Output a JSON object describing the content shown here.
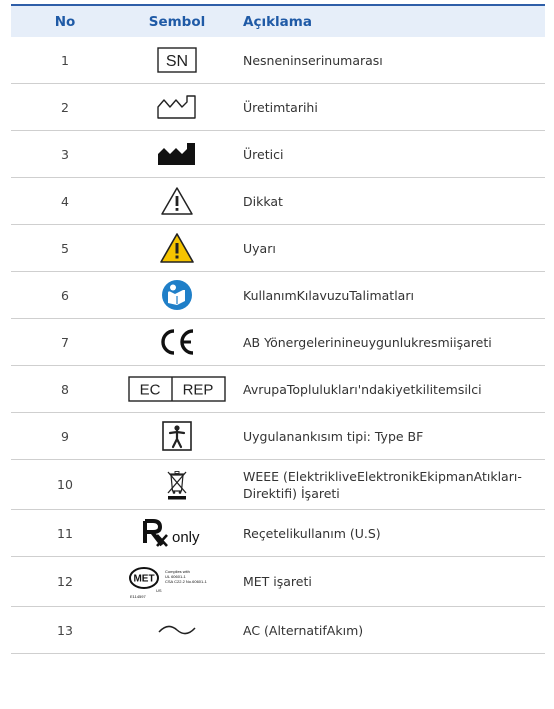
{
  "table": {
    "headers": {
      "no": "No",
      "symbol": "Sembol",
      "description": "Açıklama"
    },
    "rows": [
      {
        "no": "1",
        "icon": "serial-number-icon",
        "desc": "Nesneninserinumarası"
      },
      {
        "no": "2",
        "icon": "manufacture-date-icon",
        "desc": "Üretimtarihi"
      },
      {
        "no": "3",
        "icon": "manufacturer-icon",
        "desc": "Üretici"
      },
      {
        "no": "4",
        "icon": "caution-icon",
        "desc": "Dikkat"
      },
      {
        "no": "5",
        "icon": "warning-icon",
        "desc": "Uyarı"
      },
      {
        "no": "6",
        "icon": "user-manual-icon",
        "desc": "KullanımKılavuzuTalimatları"
      },
      {
        "no": "7",
        "icon": "ce-mark-icon",
        "desc": "AB Yönergelerinineuygunlukresmiişareti"
      },
      {
        "no": "8",
        "icon": "ec-rep-icon",
        "desc": "AvrupaToplulukları'ndakiyetkilitemsilci"
      },
      {
        "no": "9",
        "icon": "type-bf-icon",
        "desc": "Uygulanankısım tipi: Type BF"
      },
      {
        "no": "10",
        "icon": "weee-icon",
        "desc": "WEEE (ElektrikliveElektronikEkipmanAtıkları-Direktifi) İşareti"
      },
      {
        "no": "11",
        "icon": "rx-only-icon",
        "desc": "Reçetelikullanım (U.S)"
      },
      {
        "no": "12",
        "icon": "met-mark-icon",
        "desc": "MET işareti"
      },
      {
        "no": "13",
        "icon": "alternating-current-icon",
        "desc": "AC (AlternatifAkım)"
      }
    ]
  },
  "symbols": {
    "sn_text": "SN",
    "ec_text": "EC",
    "rep_text": "REP",
    "rx_only_text": "only",
    "met_text": "MET",
    "met_complies": "Complies with",
    "met_ul": "UL 60601-1",
    "met_csa": "CSA C22.2 No.60601-1",
    "met_code": "E114597",
    "met_us": "US"
  },
  "colors": {
    "header_text": "#1f5aa6",
    "header_bg": "#e6eef9",
    "warning_yellow": "#f5c400",
    "manual_blue": "#1f7fc8"
  }
}
